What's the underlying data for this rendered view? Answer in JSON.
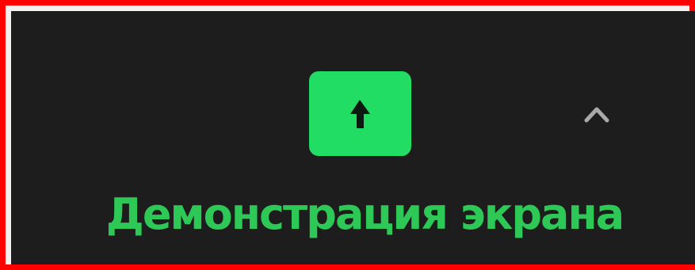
{
  "toolbar": {
    "share_screen": {
      "label": "Демонстрация экрана",
      "icon": "arrow-up-icon",
      "accent_color": "#21dd63",
      "label_color": "#2ec857"
    },
    "options": {
      "icon": "chevron-up-icon"
    },
    "background_color": "#1d1d1d"
  },
  "highlight_border_color": "#ff0000"
}
